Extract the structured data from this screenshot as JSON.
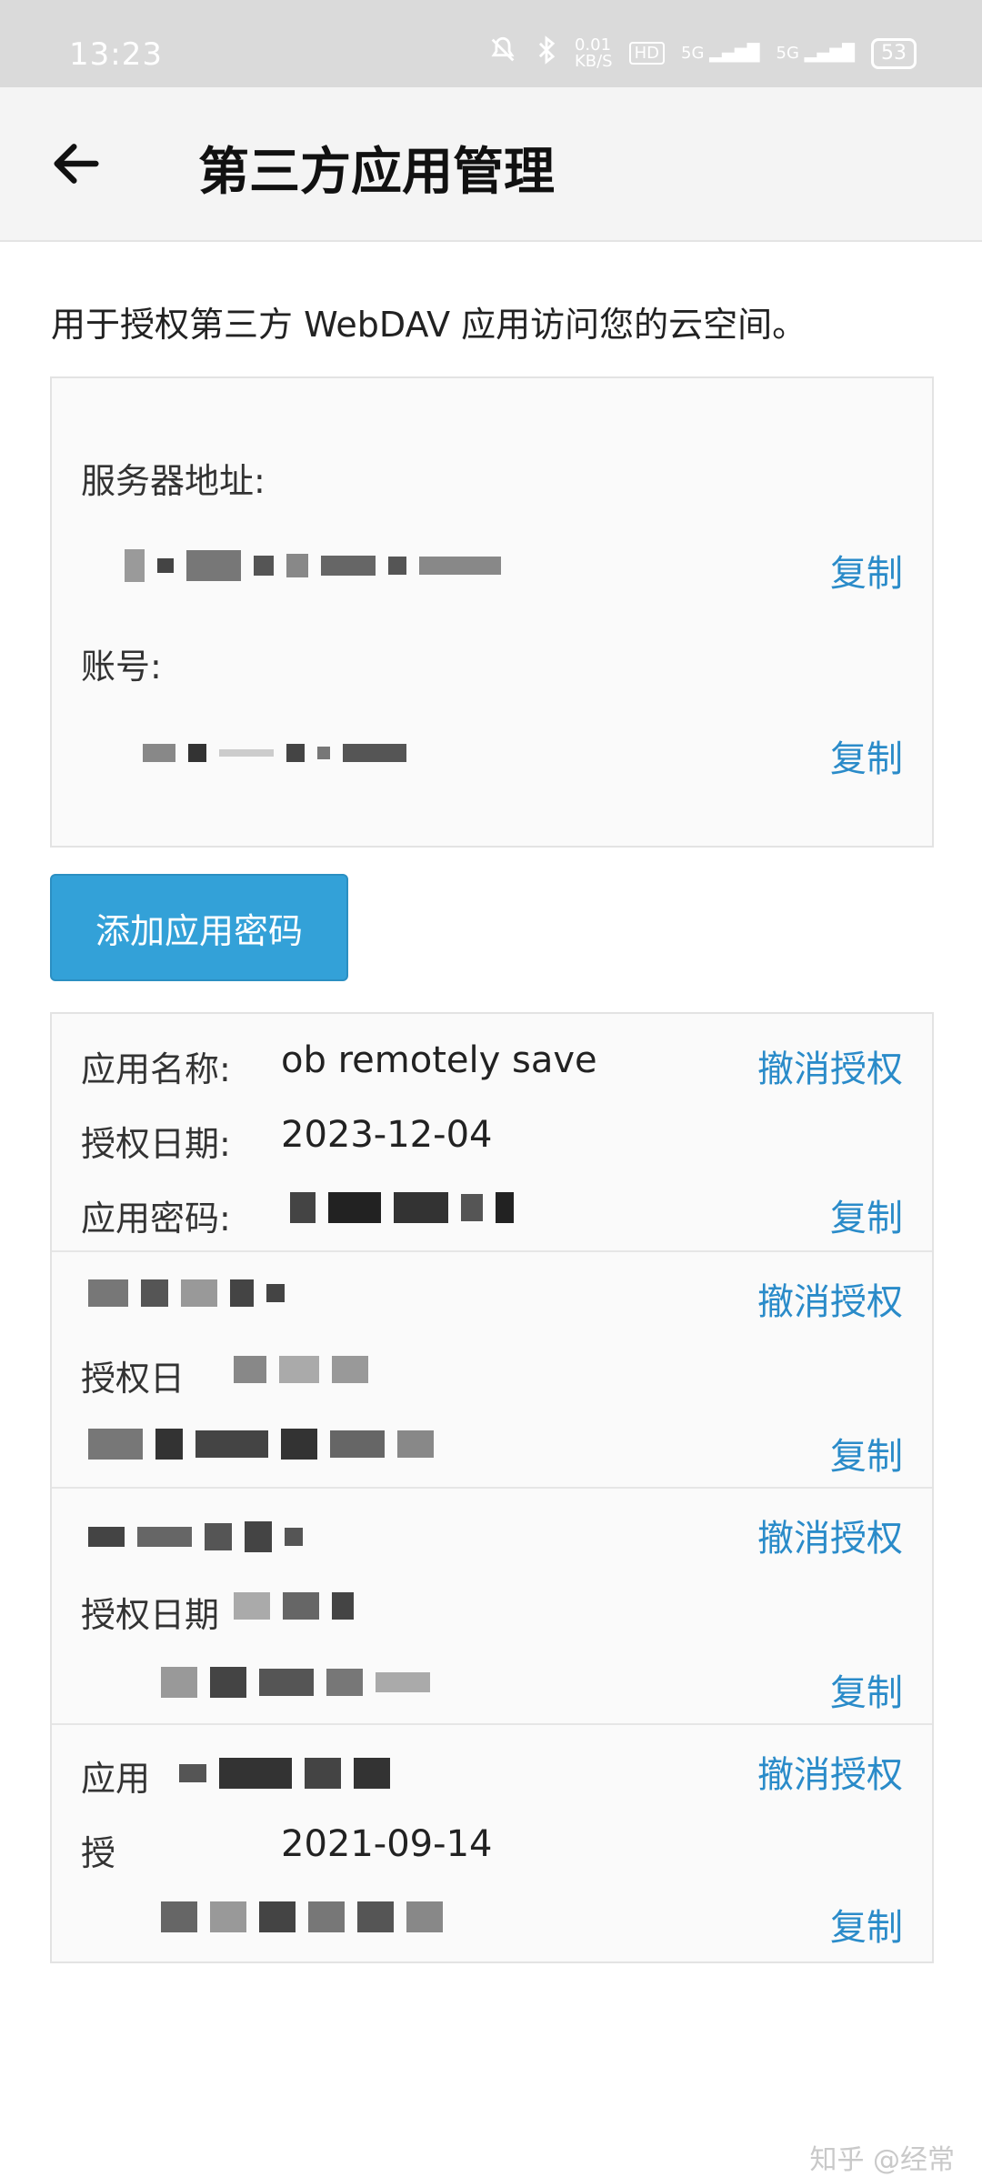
{
  "status_bar": {
    "time": "13:23",
    "speed": "0.01\nKB/S",
    "hd": "HD",
    "signal1": "5G",
    "signal2": "5G",
    "battery": "53"
  },
  "header": {
    "title": "第三方应用管理"
  },
  "description": "用于授权第三方 WebDAV 应用访问您的云空间。",
  "server": {
    "address_label": "服务器地址:",
    "account_label": "账号:",
    "copy_label": "复制"
  },
  "add_button": "添加应用密码",
  "apps": [
    {
      "name_label": "应用名称:",
      "name": "ob remotely save",
      "date_label": "授权日期:",
      "date": "2023-12-04",
      "password_label": "应用密码:",
      "revoke": "撤消授权",
      "copy": "复制"
    },
    {
      "name_label": "",
      "name": "",
      "date_label": "授权日",
      "date": "",
      "password_label": "",
      "revoke": "撤消授权",
      "copy": "复制"
    },
    {
      "name_label": "",
      "name": "",
      "date_label": "授权日期",
      "date": "",
      "password_label": "",
      "revoke": "撤消授权",
      "copy": "复制"
    },
    {
      "name_label": "应用",
      "name": "",
      "date_label": "授",
      "date": "2021-09-14",
      "password_label": "",
      "revoke": "撤消授权",
      "copy": "复制"
    }
  ],
  "watermark": "知乎 @经常",
  "colors": {
    "accent": "#2a8bc9",
    "button": "#33a1d8",
    "status_bar": "#dadada",
    "app_bar": "#f4f4f4"
  },
  "icons": {
    "back": "arrow-left-icon",
    "mute": "bell-off-icon",
    "bluetooth": "bluetooth-icon"
  }
}
